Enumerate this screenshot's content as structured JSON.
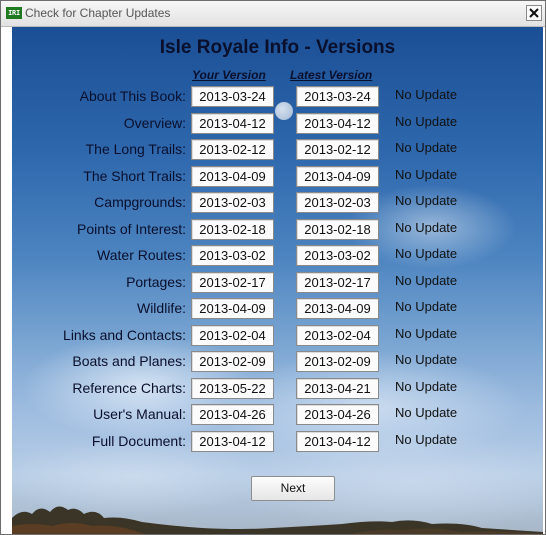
{
  "window": {
    "app_icon_text": "IRI",
    "title": "Check for Chapter Updates"
  },
  "heading": "Isle Royale Info - Versions",
  "columns": {
    "your_version": "Your Version",
    "latest_version": "Latest Version"
  },
  "rows": [
    {
      "label": "About This Book:",
      "your": "2013-03-24",
      "latest": "2013-03-24",
      "status": "No Update"
    },
    {
      "label": "Overview:",
      "your": "2013-04-12",
      "latest": "2013-04-12",
      "status": "No Update"
    },
    {
      "label": "The Long Trails:",
      "your": "2013-02-12",
      "latest": "2013-02-12",
      "status": "No Update"
    },
    {
      "label": "The Short Trails:",
      "your": "2013-04-09",
      "latest": "2013-04-09",
      "status": "No Update"
    },
    {
      "label": "Campgrounds:",
      "your": "2013-02-03",
      "latest": "2013-02-03",
      "status": "No Update"
    },
    {
      "label": "Points of Interest:",
      "your": "2013-02-18",
      "latest": "2013-02-18",
      "status": "No Update"
    },
    {
      "label": "Water Routes:",
      "your": "2013-03-02",
      "latest": "2013-03-02",
      "status": "No Update"
    },
    {
      "label": "Portages:",
      "your": "2013-02-17",
      "latest": "2013-02-17",
      "status": "No Update"
    },
    {
      "label": "Wildlife:",
      "your": "2013-04-09",
      "latest": "2013-04-09",
      "status": "No Update"
    },
    {
      "label": "Links and Contacts:",
      "your": "2013-02-04",
      "latest": "2013-02-04",
      "status": "No Update"
    },
    {
      "label": "Boats and Planes:",
      "your": "2013-02-09",
      "latest": "2013-02-09",
      "status": "No Update"
    },
    {
      "label": "Reference Charts:",
      "your": "2013-05-22",
      "latest": "2013-04-21",
      "status": "No Update"
    },
    {
      "label": "User's Manual:",
      "your": "2013-04-26",
      "latest": "2013-04-26",
      "status": "No Update"
    },
    {
      "label": "Full Document:",
      "your": "2013-04-12",
      "latest": "2013-04-12",
      "status": "No Update"
    }
  ],
  "buttons": {
    "next": "Next"
  },
  "icons": {
    "app": "iri-app-icon",
    "close": "close-icon"
  },
  "colors": {
    "app_icon_bg": "#1f7a1f",
    "heading_text": "#0a0f2c",
    "sky_top": "#1b4f95",
    "sky_bottom": "#b7cde6"
  }
}
